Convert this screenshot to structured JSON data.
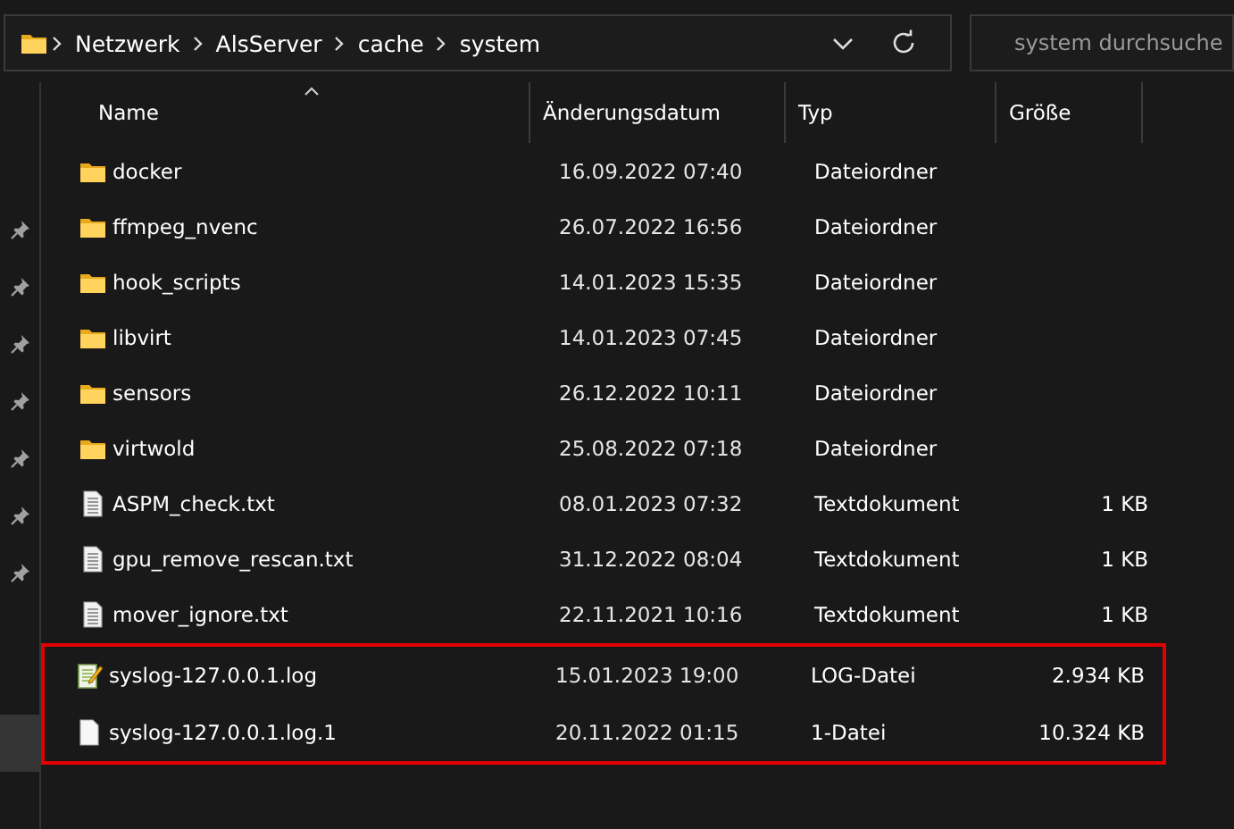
{
  "address_bar": {
    "path": [
      "Netzwerk",
      "AlsServer",
      "cache",
      "system"
    ]
  },
  "search": {
    "placeholder": "system durchsuche"
  },
  "sidebar": {
    "items": [
      {
        "pinned": true,
        "selected": false
      },
      {
        "pinned": true,
        "selected": false
      },
      {
        "pinned": true,
        "selected": false
      },
      {
        "pinned": true,
        "selected": false
      },
      {
        "pinned": true,
        "selected": false
      },
      {
        "pinned": true,
        "selected": false
      },
      {
        "pinned": true,
        "selected": false
      },
      {
        "pinned": false,
        "selected": true
      }
    ]
  },
  "table": {
    "columns": [
      {
        "label": "Name",
        "sorted": true
      },
      {
        "label": "Änderungsdatum",
        "sorted": false
      },
      {
        "label": "Typ",
        "sorted": false
      },
      {
        "label": "Größe",
        "sorted": false
      }
    ],
    "rows": [
      {
        "kind": "folder",
        "name": "docker",
        "date": "16.09.2022 07:40",
        "type": "Dateiordner",
        "highlighted": false
      },
      {
        "kind": "folder",
        "name": "ffmpeg_nvenc",
        "date": "26.07.2022 16:56",
        "type": "Dateiordner",
        "highlighted": false
      },
      {
        "kind": "folder",
        "name": "hook_scripts",
        "date": "14.01.2023 15:35",
        "type": "Dateiordner",
        "highlighted": false
      },
      {
        "kind": "folder",
        "name": "libvirt",
        "date": "14.01.2023 07:45",
        "type": "Dateiordner",
        "highlighted": false
      },
      {
        "kind": "folder",
        "name": "sensors",
        "date": "26.12.2022 10:11",
        "type": "Dateiordner",
        "highlighted": false
      },
      {
        "kind": "folder",
        "name": "virtwold",
        "date": "25.08.2022 07:18",
        "type": "Dateiordner",
        "highlighted": false
      },
      {
        "kind": "text",
        "name": "ASPM_check.txt",
        "date": "08.01.2023 07:32",
        "type": "Textdokument",
        "size": "1 KB",
        "highlighted": false
      },
      {
        "kind": "text",
        "name": "gpu_remove_rescan.txt",
        "date": "31.12.2022 08:04",
        "type": "Textdokument",
        "size": "1 KB",
        "highlighted": false
      },
      {
        "kind": "text",
        "name": "mover_ignore.txt",
        "date": "22.11.2021 10:16",
        "type": "Textdokument",
        "size": "1 KB",
        "highlighted": false
      },
      {
        "kind": "log",
        "name": "syslog-127.0.0.1.log",
        "date": "15.01.2023 19:00",
        "type": "LOG-Datei",
        "size": "2.934 KB",
        "highlighted": true
      },
      {
        "kind": "file",
        "name": "syslog-127.0.0.1.log.1",
        "date": "20.11.2022 01:15",
        "type": "1-Datei",
        "size": "10.324 KB",
        "highlighted": true
      }
    ]
  }
}
